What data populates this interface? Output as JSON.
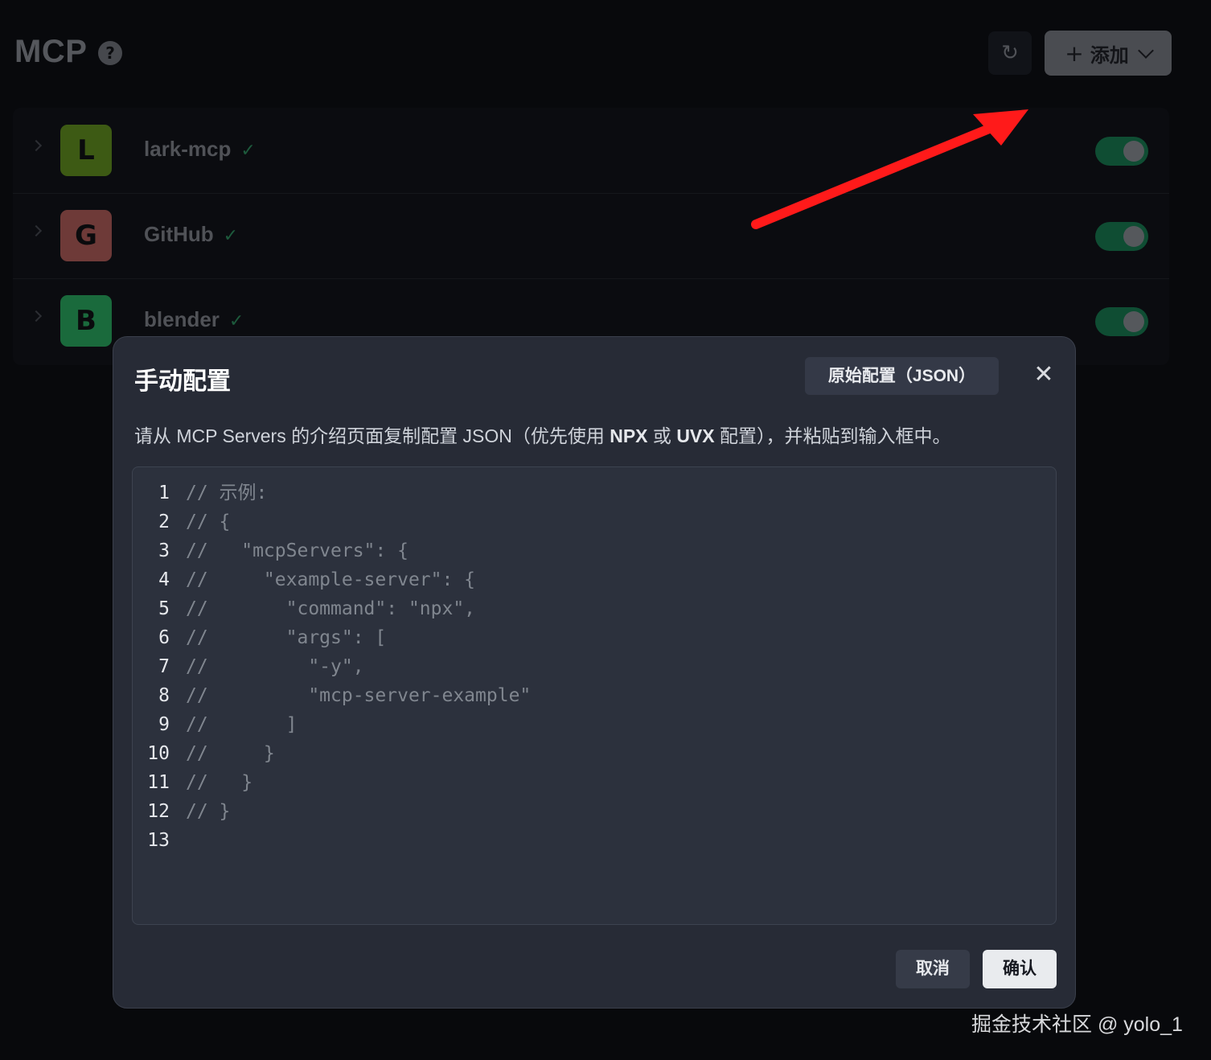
{
  "header": {
    "title": "MCP",
    "help_icon": "?",
    "refresh_icon": "↻",
    "add_button": {
      "icon": "+",
      "label": "添加"
    }
  },
  "servers": [
    {
      "letter": "L",
      "name": "lark-mcp",
      "avatar_color": "#3d5a14",
      "enabled": true,
      "status_icon": "✓"
    },
    {
      "letter": "G",
      "name": "GitHub",
      "avatar_color": "#6e3a38",
      "enabled": true,
      "status_icon": "✓"
    },
    {
      "letter": "B",
      "name": "blender",
      "avatar_color": "#1a6a3c",
      "enabled": true,
      "status_icon": "✓"
    }
  ],
  "modal": {
    "title": "手动配置",
    "json_button": "原始配置（JSON）",
    "close_icon": "✕",
    "description_parts": [
      "请从 MCP Servers 的介绍页面复制配置 JSON（优先使用 ",
      "NPX",
      " 或 ",
      "UVX",
      " 配置），并粘贴到输入框中。"
    ],
    "code_lines": [
      "// 示例:",
      "// {",
      "//   \"mcpServers\": {",
      "//     \"example-server\": {",
      "//       \"command\": \"npx\",",
      "//       \"args\": [",
      "//         \"-y\",",
      "//         \"mcp-server-example\"",
      "//       ]",
      "//     }",
      "//   }",
      "// }",
      ""
    ],
    "cancel_button": "取消",
    "confirm_button": "确认"
  },
  "watermark": "掘金技术社区 @ yolo_1",
  "colors": {
    "background": "#08090c",
    "modal_bg": "#272b36",
    "toggle_on": "#0f4d33",
    "annotation_arrow": "#ff1a1a"
  }
}
